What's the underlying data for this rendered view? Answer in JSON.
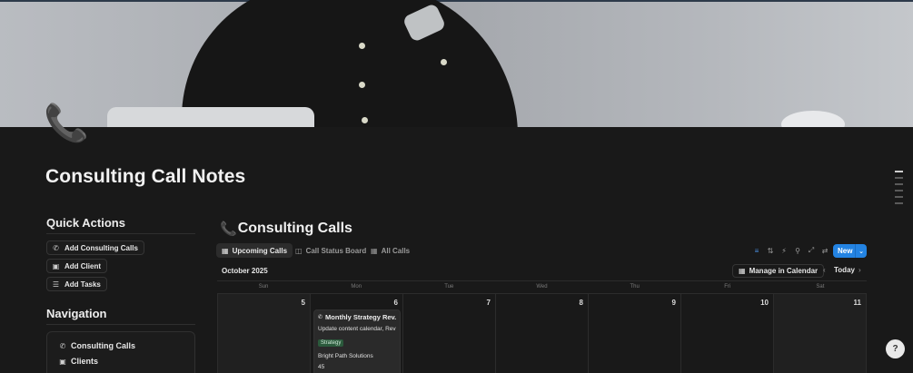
{
  "page": {
    "icon": "telephone-icon",
    "title": "Consulting Call Notes"
  },
  "quick_actions": {
    "heading": "Quick Actions",
    "buttons": [
      {
        "label": "Add Consulting Calls",
        "icon": "phone-icon"
      },
      {
        "label": "Add Client",
        "icon": "briefcase-icon"
      },
      {
        "label": "Add Tasks",
        "icon": "checklist-icon"
      }
    ]
  },
  "navigation": {
    "heading": "Navigation",
    "items": [
      {
        "label": "Consulting Calls",
        "icon": "phone-icon"
      },
      {
        "label": "Clients",
        "icon": "briefcase-icon"
      }
    ]
  },
  "database": {
    "title": "Consulting Calls",
    "icon": "phone-icon",
    "tabs": [
      {
        "label": "Upcoming Calls",
        "icon": "calendar-icon",
        "active": true
      },
      {
        "label": "Call Status Board",
        "icon": "board-icon",
        "active": false
      },
      {
        "label": "All Calls",
        "icon": "table-icon",
        "active": false
      }
    ],
    "new_label": "New",
    "month_label": "October 2025",
    "manage_label": "Manage in Calendar",
    "today_label": "Today",
    "weekdays": [
      "Sun",
      "Mon",
      "Tue",
      "Wed",
      "Thu",
      "Fri",
      "Sat"
    ],
    "days": [
      "5",
      "6",
      "7",
      "8",
      "9",
      "10",
      "11"
    ],
    "event": {
      "title": "Monthly Strategy Rev...",
      "tasks": "Update content calendar, Revise",
      "tag": "Strategy",
      "client": "Bright Path Solutions",
      "duration": "45"
    }
  },
  "colors": {
    "background": "#191919",
    "accent": "#2383e2",
    "tag_green": "#2b5a3c"
  }
}
